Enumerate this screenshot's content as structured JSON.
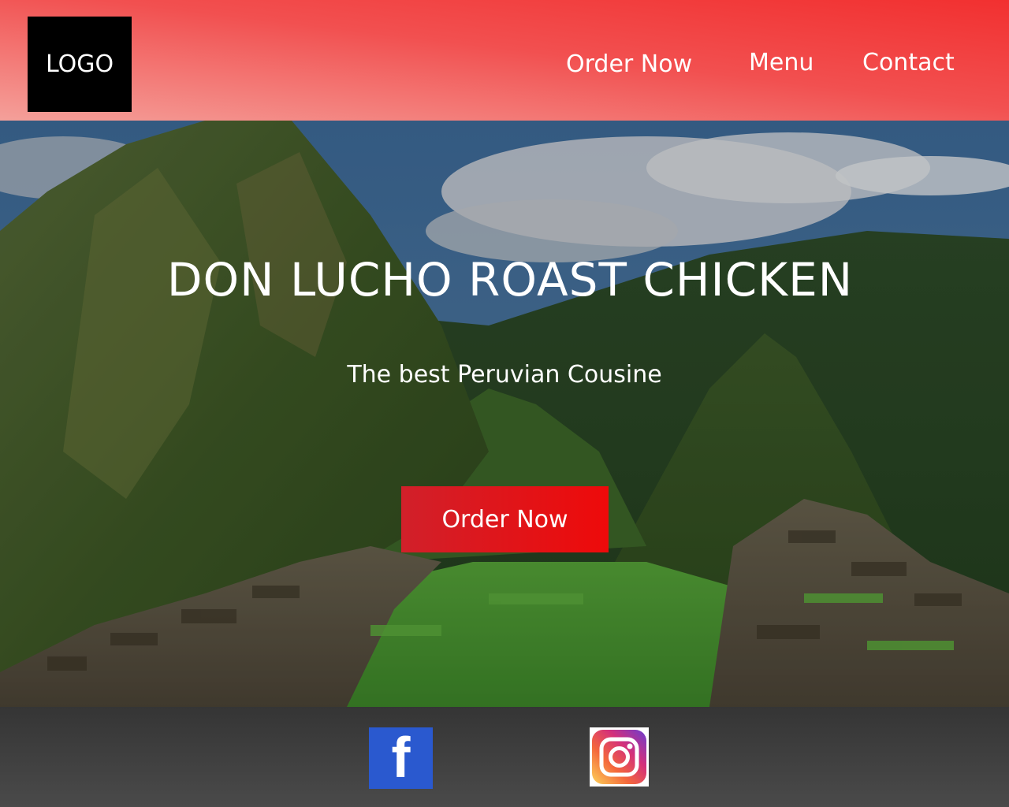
{
  "header": {
    "logo_text": "LOGO",
    "nav": {
      "order_now": "Order Now",
      "menu": "Menu",
      "contact": "Contact"
    }
  },
  "hero": {
    "title": "DON LUCHO ROAST CHICKEN",
    "subtitle": "The best Peruvian Cousine",
    "button_label": "Order Now",
    "background_image": "mountain-ruins-landscape"
  },
  "footer": {
    "social": {
      "facebook_glyph": "f",
      "facebook_icon": "facebook-icon",
      "instagram_icon": "instagram-icon"
    }
  },
  "colors": {
    "header_red": "#f23030",
    "button_red": "#ee0a0a",
    "footer_gray": "#3a3a3a",
    "facebook_blue": "#2a59cf"
  }
}
